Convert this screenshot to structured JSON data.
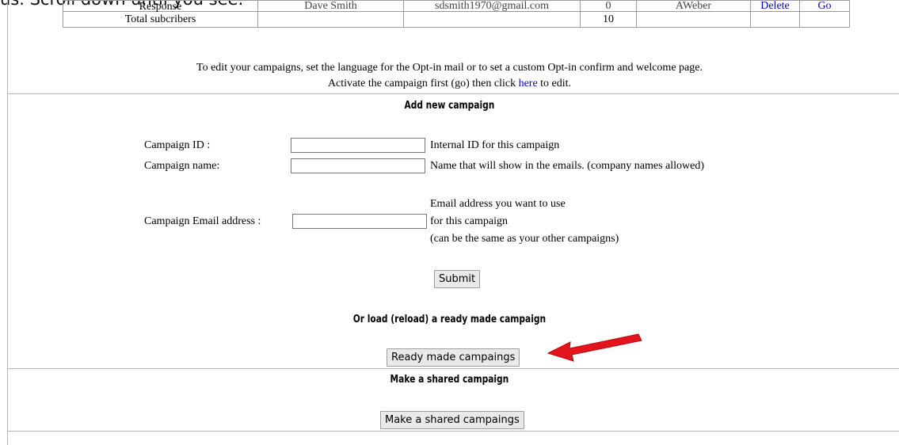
{
  "caption": "us.  Scroll down until you see:",
  "table": {
    "partial_row": {
      "col1": "Response",
      "col2": "Dave Smith",
      "col3": "sdsmith1970@gmail.com",
      "col4": "0",
      "col5": "AWeber",
      "col6": "Delete",
      "col7": "Go"
    },
    "total_row": {
      "label": "Total subcribers",
      "count": "10"
    }
  },
  "info": {
    "line1": "To edit your campaigns, set the language for the Opt-in mail or to set a custom Opt-in confirm and welcome page.",
    "line2_before": "Activate the campaign first (go) then click ",
    "line2_link": "here",
    "line2_after": " to edit."
  },
  "add_campaign": {
    "heading": "Add new campaign",
    "id_label": "Campaign ID :",
    "id_value": "",
    "id_hint": "Internal ID for this campaign",
    "name_label": "Campaign name:",
    "name_value": "",
    "name_hint": "Name that will show in the emails. (company names allowed)",
    "email_label": "Campaign Email address :",
    "email_value": "",
    "email_hint_1": "Email address you want to use",
    "email_hint_2": "for this campaign",
    "email_hint_3": "(can be the same as your other campaigns)",
    "submit_label": "Submit"
  },
  "ready_made": {
    "heading": "Or load (reload) a ready made campaign",
    "button_label": "Ready made campaings"
  },
  "shared": {
    "heading": "Make a shared campaign",
    "button_label": "Make a shared campaings"
  },
  "colors": {
    "link": "#0000ee",
    "arrow": "#e3141b",
    "button_bg": "#e9e9e9",
    "rule": "#b5b5b5"
  },
  "icons": {
    "pointer": "red-arrow-icon"
  }
}
